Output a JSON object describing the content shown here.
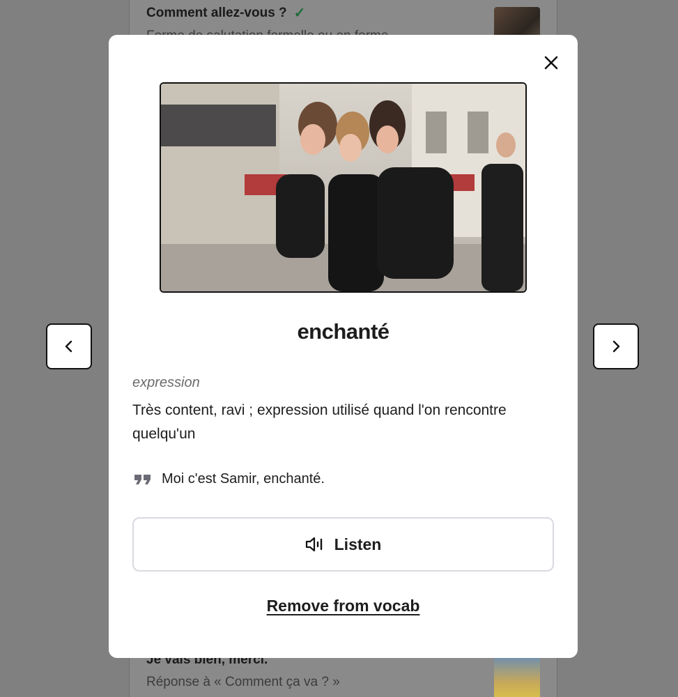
{
  "background_list": {
    "top_item": {
      "title": "Comment allez-vous ?",
      "subtitle": "Forme de salutation formelle ou en forme"
    },
    "bottom_item": {
      "title": "Je vais bien, merci.",
      "subtitle": "Réponse à « Comment ça va ? »"
    }
  },
  "navigation": {
    "prev_icon": "chevron-left-icon",
    "next_icon": "chevron-right-icon"
  },
  "card": {
    "close_icon": "close-icon",
    "word": "enchanté",
    "part_of_speech": "expression",
    "definition": "Très content, ravi ; expression utilisé quand l'on rencontre quelqu'un",
    "example": "Moi c'est Samir, enchanté.",
    "example_icon": "quote-icon",
    "listen_label": "Listen",
    "listen_icon": "speaker-icon",
    "remove_label": "Remove from vocab"
  },
  "colors": {
    "overlay": "#808080",
    "card": "#ffffff",
    "text": "#1d1d1d",
    "muted": "#6b6b6b",
    "check": "#1f6b3a"
  }
}
